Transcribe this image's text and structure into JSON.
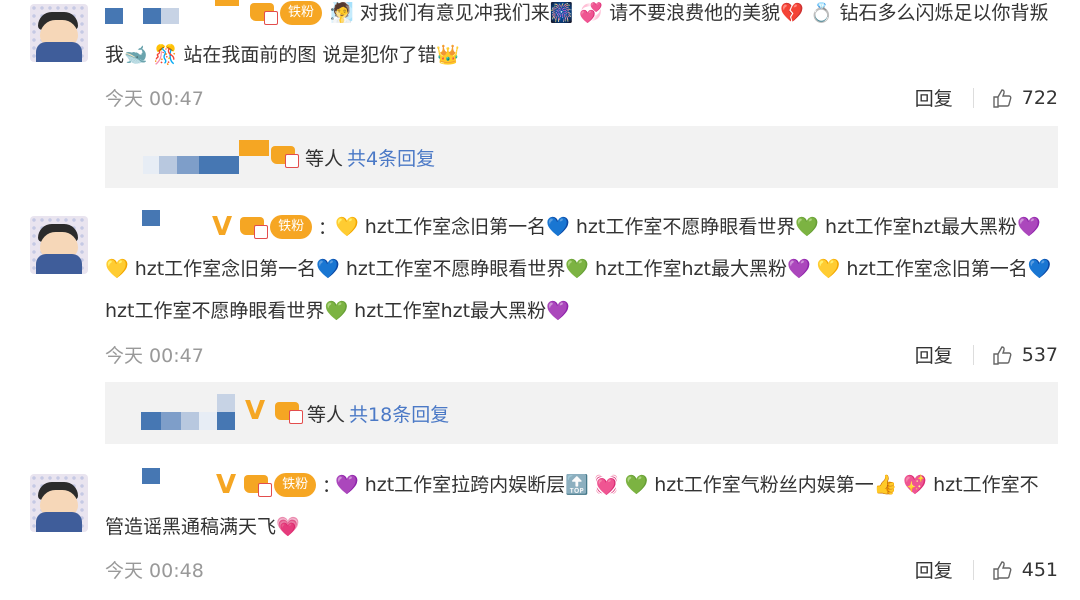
{
  "comments": [
    {
      "fan_label": "铁粉",
      "colon": "：",
      "text": "🧖 对我们有意见冲我们来🎆 💞 请不要浪费他的美貌💔 💍 钻石多么闪烁足以你背叛我🐋 🎊 站在我面前的图 说是犯你了错👑",
      "time": "今天 00:47",
      "reply_label": "回复",
      "likes": "722",
      "thread": {
        "people_label": "等人",
        "count_text": "共4条回复"
      }
    },
    {
      "fan_label": "铁粉",
      "colon": "：",
      "text": "💛 hzt工作室念旧第一名💙 hzt工作室不愿睁眼看世界💚 hzt工作室hzt最大黑粉💜 💛 hzt工作室念旧第一名💙 hzt工作室不愿睁眼看世界💚 hzt工作室hzt最大黑粉💜 💛 hzt工作室念旧第一名💙 hzt工作室不愿睁眼看世界💚 hzt工作室hzt最大黑粉💜",
      "time": "今天 00:47",
      "reply_label": "回复",
      "likes": "537",
      "thread": {
        "people_label": "等人",
        "count_text": "共18条回复"
      }
    },
    {
      "fan_label": "铁粉",
      "colon": "：",
      "text": "💜 hzt工作室拉跨内娱断层🔝 💓 💚 hzt工作室气粉丝内娱第一👍 💖 hzt工作室不管造谣黑通稿满天飞💗",
      "time": "今天 00:48",
      "reply_label": "回复",
      "likes": "451"
    }
  ],
  "colors": {
    "link": "#4b79c6",
    "badge": "#f6a623",
    "muted": "#999999"
  },
  "icons": [
    "avatar",
    "v-icon",
    "crown-icon",
    "like-icon"
  ]
}
